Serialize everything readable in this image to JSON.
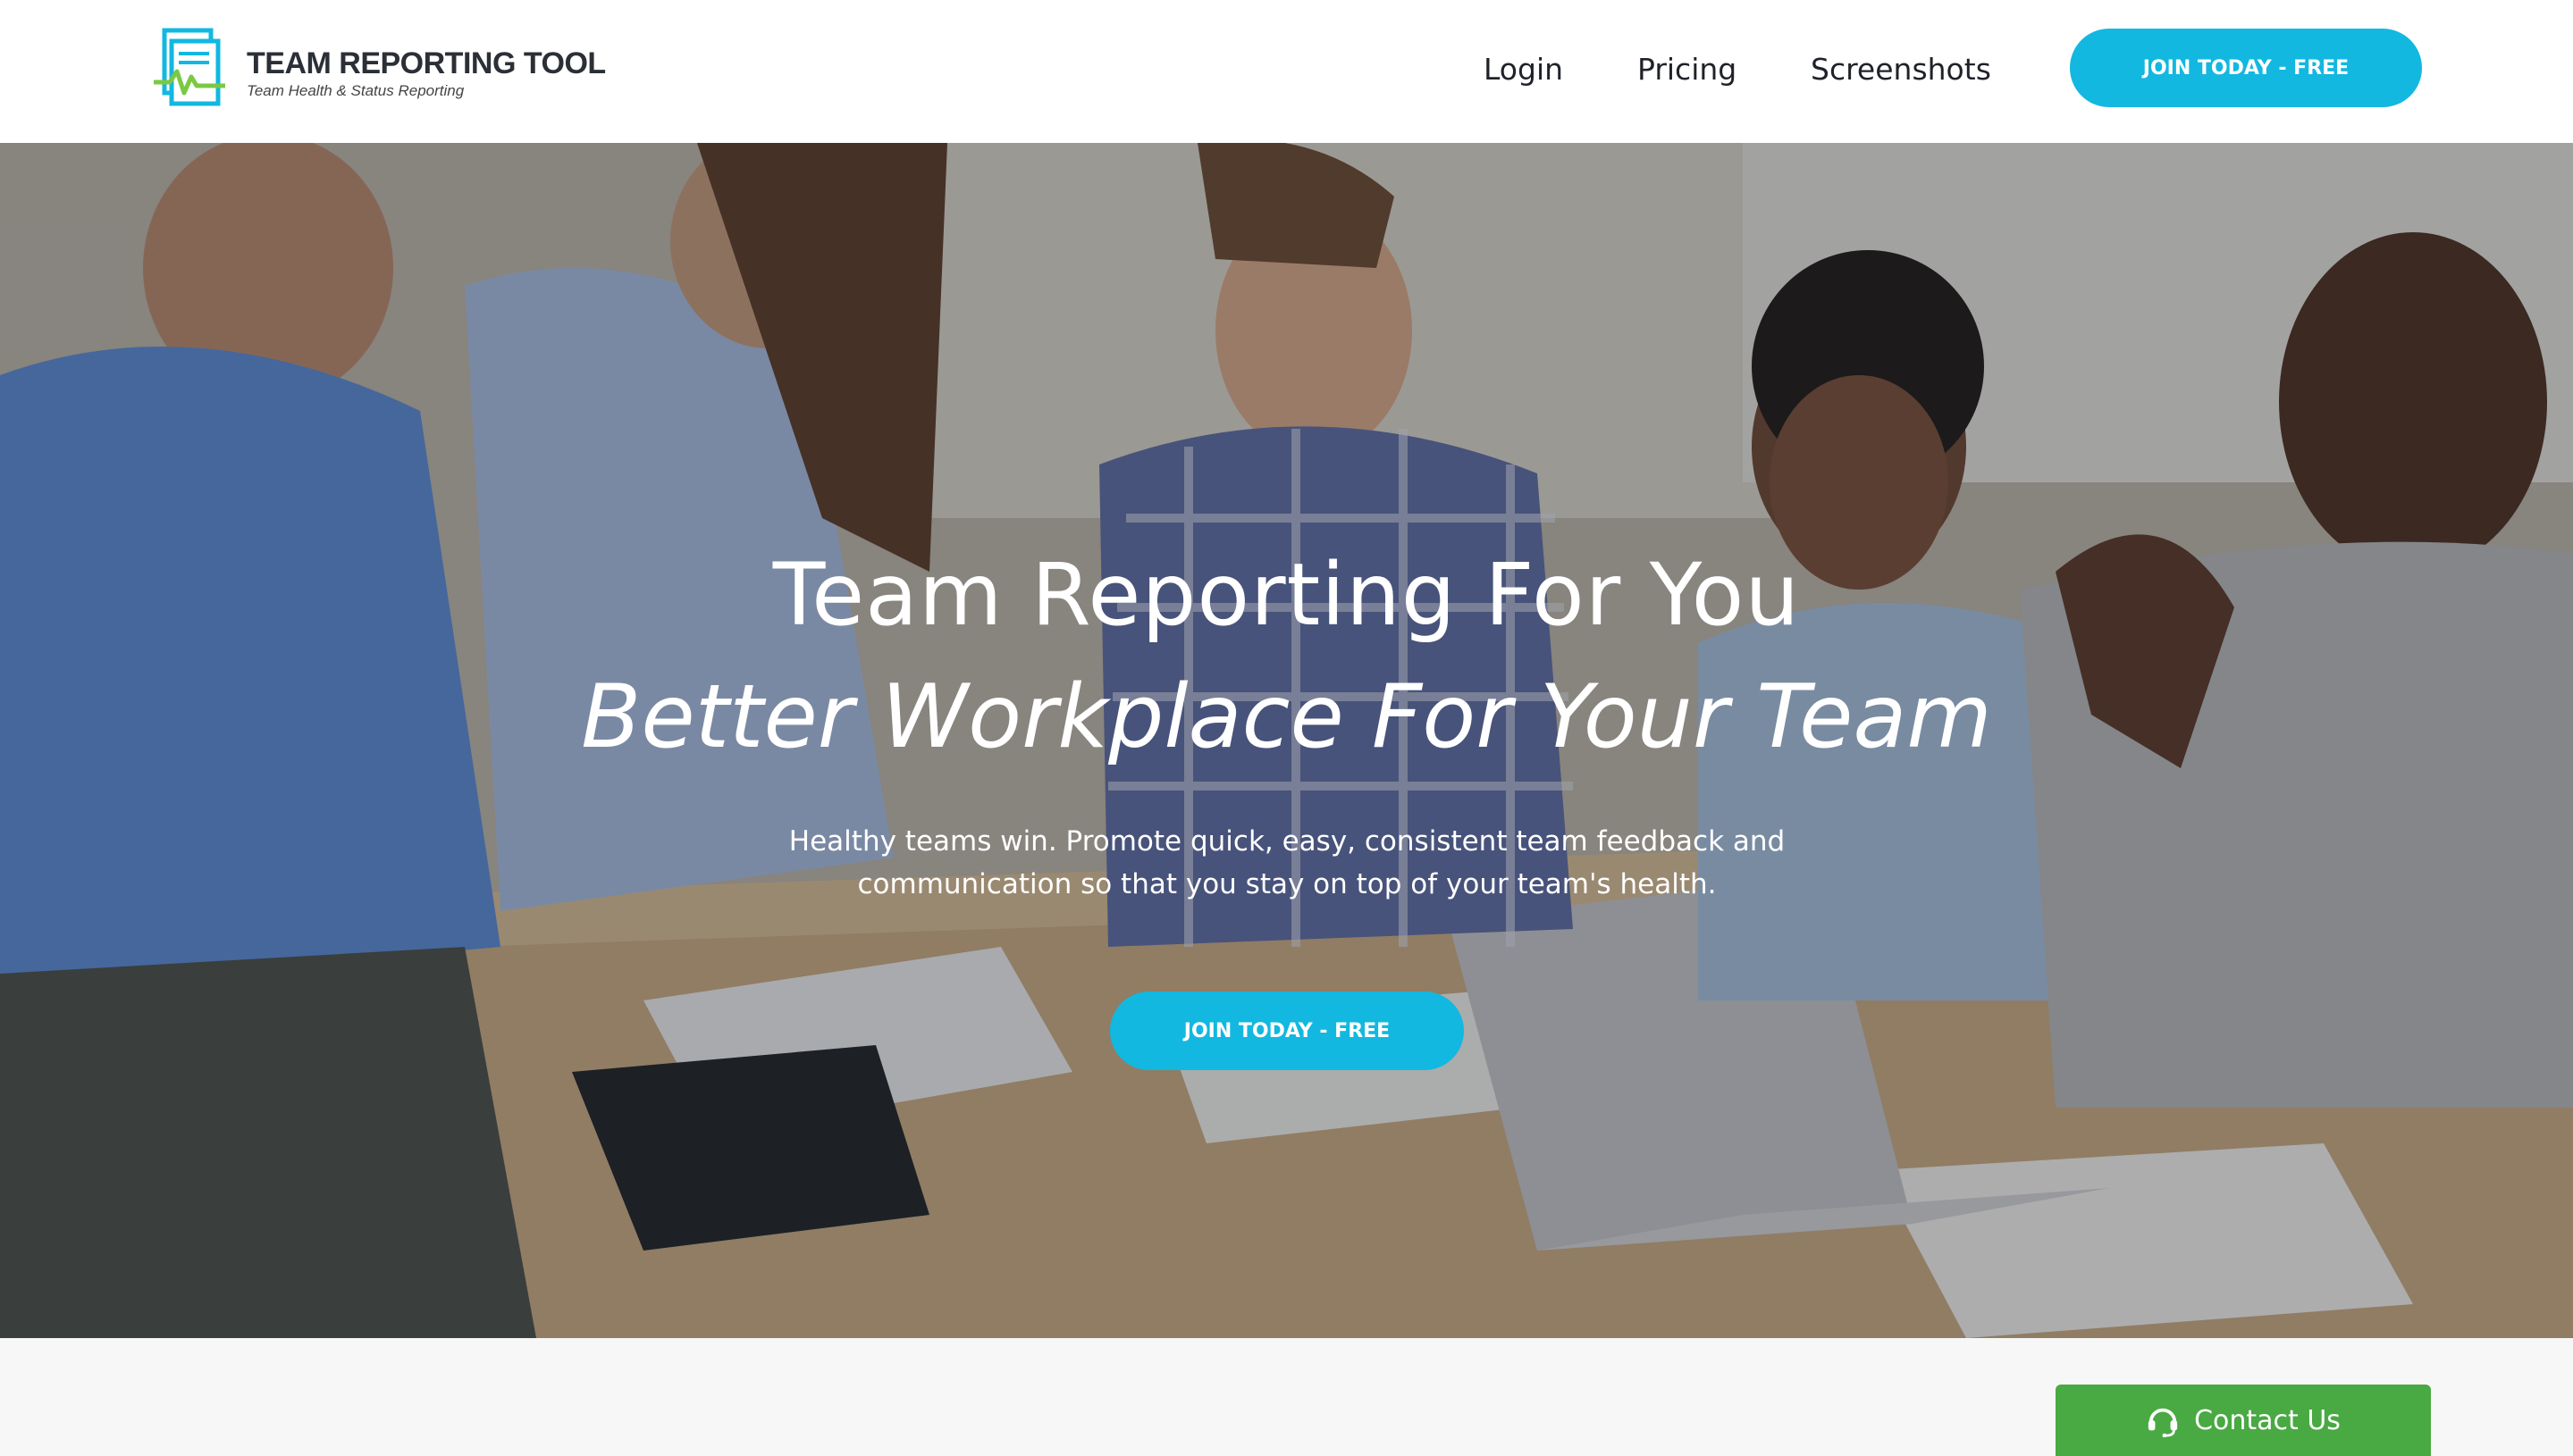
{
  "brand": {
    "name": "TEAM REPORTING TOOL",
    "tagline": "Team Health & Status Reporting",
    "logo_icon": "report-pulse-icon",
    "accent": "#12b8e0",
    "pulse": "#7ac943"
  },
  "nav": {
    "links": [
      {
        "label": "Login"
      },
      {
        "label": "Pricing"
      },
      {
        "label": "Screenshots"
      }
    ],
    "cta_label": "JOIN TODAY - FREE"
  },
  "hero": {
    "title_line1": "Team Reporting For You",
    "title_line2": "Better Workplace For Your Team",
    "description": "Healthy teams win. Promote quick, easy, consistent team feedback and communication so that you stay on top of your team's health.",
    "cta_label": "JOIN TODAY - FREE"
  },
  "contact": {
    "label": "Contact Us",
    "icon": "headset-icon",
    "color": "#49a942"
  }
}
